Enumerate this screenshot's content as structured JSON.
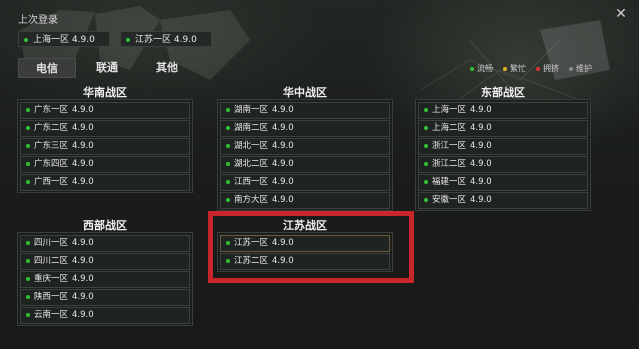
{
  "window": {
    "close_glyph": "✕"
  },
  "last_login": {
    "title": "上次登录",
    "servers": [
      {
        "name": "上海一区",
        "version": "4.9.0",
        "status": "流畅"
      },
      {
        "name": "江苏一区",
        "version": "4.9.0",
        "status": "流畅"
      }
    ]
  },
  "isp_tabs": [
    {
      "label": "电信",
      "active": true
    },
    {
      "label": "联通",
      "active": false
    },
    {
      "label": "其他",
      "active": false
    }
  ],
  "legend": [
    {
      "label": "流畅",
      "color": "#2fc22f"
    },
    {
      "label": "繁忙",
      "color": "#e0b020"
    },
    {
      "label": "拥挤",
      "color": "#e03030"
    },
    {
      "label": "维护",
      "color": "#8a8a8a"
    }
  ],
  "regions": [
    {
      "title": "华南战区",
      "servers": [
        {
          "name": "广东一区",
          "version": "4.9.0",
          "status": "流畅"
        },
        {
          "name": "广东二区",
          "version": "4.9.0",
          "status": "流畅"
        },
        {
          "name": "广东三区",
          "version": "4.9.0",
          "status": "流畅"
        },
        {
          "name": "广东四区",
          "version": "4.9.0",
          "status": "流畅"
        },
        {
          "name": "广西一区",
          "version": "4.9.0",
          "status": "流畅"
        }
      ]
    },
    {
      "title": "华中战区",
      "servers": [
        {
          "name": "湖南一区",
          "version": "4.9.0",
          "status": "流畅"
        },
        {
          "name": "湖南二区",
          "version": "4.9.0",
          "status": "流畅"
        },
        {
          "name": "湖北一区",
          "version": "4.9.0",
          "status": "流畅"
        },
        {
          "name": "湖北二区",
          "version": "4.9.0",
          "status": "流畅"
        },
        {
          "name": "江西一区",
          "version": "4.9.0",
          "status": "流畅"
        },
        {
          "name": "南方大区",
          "version": "4.9.0",
          "status": "流畅"
        }
      ]
    },
    {
      "title": "东部战区",
      "servers": [
        {
          "name": "上海一区",
          "version": "4.9.0",
          "status": "流畅"
        },
        {
          "name": "上海二区",
          "version": "4.9.0",
          "status": "流畅"
        },
        {
          "name": "浙江一区",
          "version": "4.9.0",
          "status": "流畅"
        },
        {
          "name": "浙江二区",
          "version": "4.9.0",
          "status": "流畅"
        },
        {
          "name": "福建一区",
          "version": "4.9.0",
          "status": "流畅"
        },
        {
          "name": "安徽一区",
          "version": "4.9.0",
          "status": "流畅"
        }
      ]
    },
    {
      "title": "西部战区",
      "servers": [
        {
          "name": "四川一区",
          "version": "4.9.0",
          "status": "流畅"
        },
        {
          "name": "四川二区",
          "version": "4.9.0",
          "status": "流畅"
        },
        {
          "name": "重庆一区",
          "version": "4.9.0",
          "status": "流畅"
        },
        {
          "name": "陕西一区",
          "version": "4.9.0",
          "status": "流畅"
        },
        {
          "name": "云南一区",
          "version": "4.9.0",
          "status": "流畅"
        }
      ]
    },
    {
      "title": "江苏战区",
      "highlighted": true,
      "servers": [
        {
          "name": "江苏一区",
          "version": "4.9.0",
          "status": "流畅"
        },
        {
          "name": "江苏二区",
          "version": "4.9.0",
          "status": "流畅"
        }
      ]
    }
  ],
  "colors": {
    "accent_highlight": "#c8262a",
    "status_green": "#2fc22f",
    "background": "#1b1e1b",
    "row_background": "#202420"
  }
}
